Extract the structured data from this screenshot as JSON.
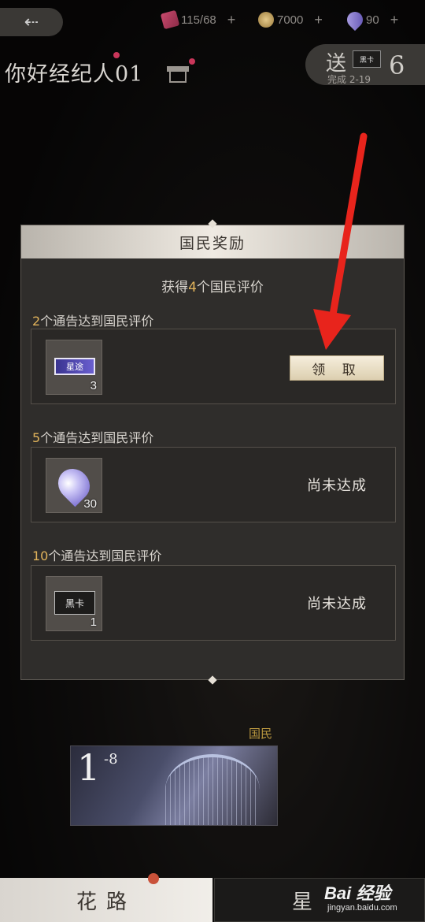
{
  "top_bar": {
    "resources": [
      {
        "icon": "heart-ticket-icon",
        "value": "115/68"
      },
      {
        "icon": "coin-icon",
        "value": "7000"
      },
      {
        "icon": "gem-icon",
        "value": "90"
      }
    ],
    "plus": "+"
  },
  "agent": {
    "title": "你好经纪人01"
  },
  "send": {
    "title": "送",
    "card_label": "黑卡",
    "number": "6",
    "subtitle": "完成 2-19"
  },
  "modal": {
    "title": "国民奖励",
    "summary_prefix": "获得",
    "summary_count": "4",
    "summary_suffix": "个国民评价",
    "tiers": [
      {
        "count": "2",
        "label_suffix": "个通告达到国民评价",
        "item_icon": "star-ticket-icon",
        "item_text": "星途",
        "item_count": "3",
        "action": "领 取",
        "state": "claimable"
      },
      {
        "count": "5",
        "label_suffix": "个通告达到国民评价",
        "item_icon": "diamond-icon",
        "item_text": "",
        "item_count": "30",
        "action": "尚未达成",
        "state": "locked"
      },
      {
        "count": "10",
        "label_suffix": "个通告达到国民评价",
        "item_icon": "black-card-icon",
        "item_text": "黑卡",
        "item_count": "1",
        "action": "尚未达成",
        "state": "locked"
      }
    ]
  },
  "scene": {
    "nation_tag": "国民",
    "stage_number": "1",
    "stage_sub": "-8"
  },
  "tabs": {
    "left": "花路",
    "right": "星"
  },
  "watermark": {
    "main": "Bai 经验",
    "sub": "jingyan.baidu.com"
  },
  "colors": {
    "accent_gold": "#e1b35b",
    "arrow_red": "#e8241c"
  }
}
